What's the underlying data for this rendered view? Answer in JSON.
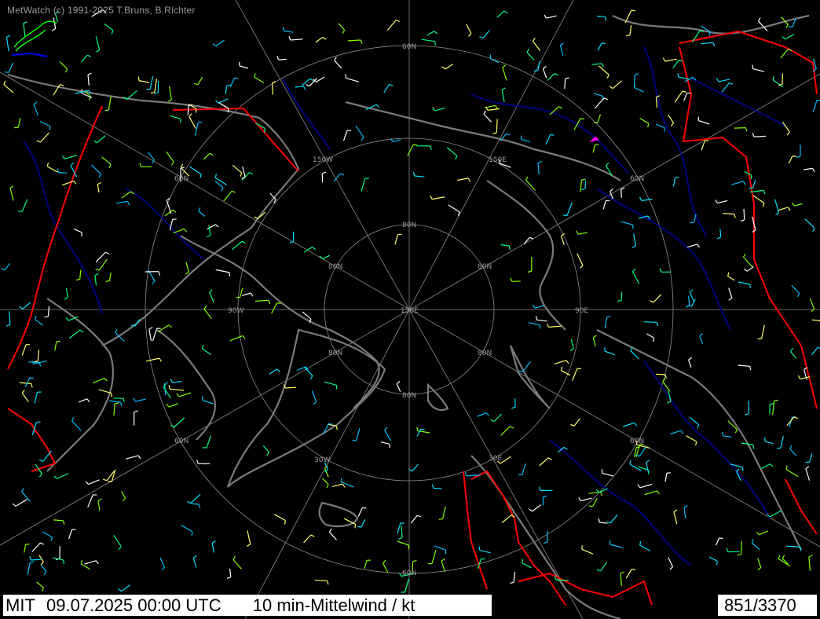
{
  "app": {
    "copyright": "MetWatch  (c) 1991-2025 T.Bruns, B.Richter"
  },
  "status": {
    "model": "MIT",
    "datetime": "09.07.2025 00:00 UTC",
    "unit": "10 min-Mittelwind / kt",
    "station_count": "851/3370"
  },
  "grid_labels": {
    "lat60_top": "60N",
    "lat70_left": "60N",
    "lat70_right": "60N",
    "lat70_bl": "60N",
    "lat70_br": "60N",
    "lat60_bottom": "60N",
    "lon150w": "150W",
    "lon150e": "150E",
    "lon90w": "90W",
    "lon90e": "90E",
    "lon30w": "30W",
    "lon30e": "30E",
    "lat80_top": "80N",
    "lat80_left": "80N",
    "lat80_right": "80N",
    "lat80_bl": "80N",
    "lat80_br": "80N",
    "lat80_bottom": "80N",
    "pole": "150E"
  },
  "colors": {
    "background": "#000000",
    "coastline": "#7a7a7a",
    "rivers": "#000080",
    "borders": "#ff0000",
    "grid": "#8c8c8c",
    "status_bar": "#ffffff"
  }
}
